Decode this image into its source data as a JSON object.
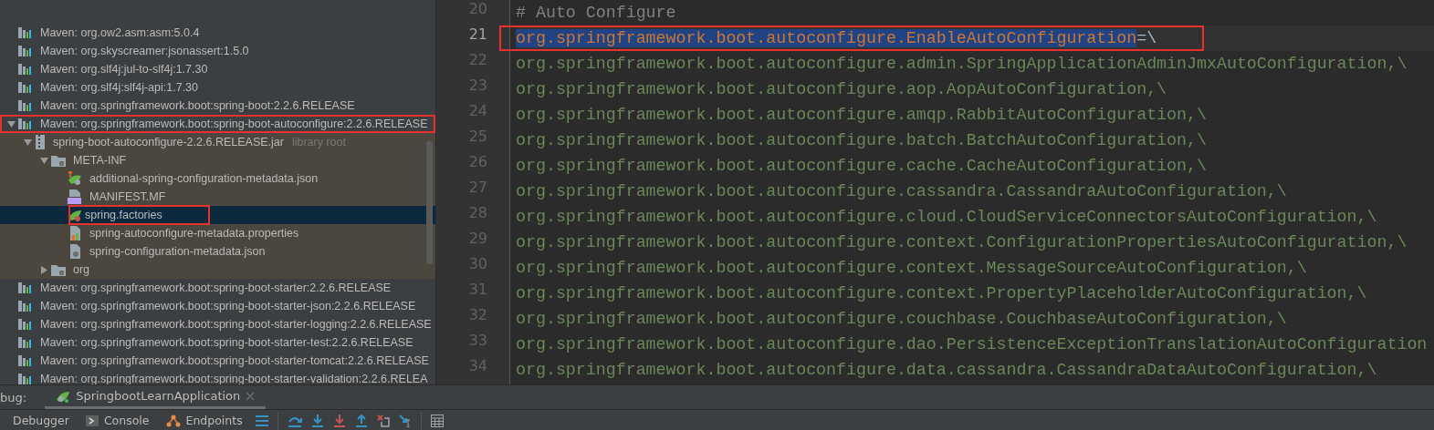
{
  "project_tree": [
    {
      "kind": "maven",
      "label": "Maven: org.ow2.asm:asm:5.0.4",
      "selected": false,
      "annotated": false
    },
    {
      "kind": "maven",
      "label": "Maven: org.skyscreamer:jsonassert:1.5.0",
      "selected": false,
      "annotated": false
    },
    {
      "kind": "maven",
      "label": "Maven: org.slf4j:jul-to-slf4j:1.7.30",
      "selected": false,
      "annotated": false
    },
    {
      "kind": "maven",
      "label": "Maven: org.slf4j:slf4j-api:1.7.30",
      "selected": false,
      "annotated": false
    },
    {
      "kind": "maven",
      "label": "Maven: org.springframework.boot:spring-boot:2.2.6.RELEASE",
      "selected": false,
      "annotated": false
    },
    {
      "kind": "maven",
      "label": "Maven: org.springframework.boot:spring-boot-autoconfigure:2.2.6.RELEASE",
      "selected": false,
      "annotated": true,
      "expanded": true,
      "children": [
        {
          "kind": "jar",
          "label": "spring-boot-autoconfigure-2.2.6.RELEASE.jar",
          "hint": "library root",
          "selected": false,
          "annotated": false,
          "expanded": true,
          "children": [
            {
              "kind": "folder",
              "label": "META-INF",
              "selected": false,
              "annotated": false,
              "expanded": true,
              "children": [
                {
                  "kind": "json-up",
                  "label": "additional-spring-configuration-metadata.json",
                  "selected": false,
                  "annotated": false
                },
                {
                  "kind": "manifest",
                  "label": "MANIFEST.MF",
                  "selected": false,
                  "annotated": false
                },
                {
                  "kind": "spring",
                  "label": "spring.factories",
                  "selected": true,
                  "annotated": true
                },
                {
                  "kind": "properties",
                  "label": "spring-autoconfigure-metadata.properties",
                  "selected": false,
                  "annotated": false
                },
                {
                  "kind": "json",
                  "label": "spring-configuration-metadata.json",
                  "selected": false,
                  "annotated": false
                }
              ]
            },
            {
              "kind": "folder",
              "label": "org",
              "selected": false,
              "annotated": false,
              "expanded": false
            }
          ]
        }
      ]
    },
    {
      "kind": "maven",
      "label": "Maven: org.springframework.boot:spring-boot-starter:2.2.6.RELEASE",
      "selected": false,
      "annotated": false
    },
    {
      "kind": "maven",
      "label": "Maven: org.springframework.boot:spring-boot-starter-json:2.2.6.RELEASE",
      "selected": false,
      "annotated": false
    },
    {
      "kind": "maven",
      "label": "Maven: org.springframework.boot:spring-boot-starter-logging:2.2.6.RELEASE",
      "selected": false,
      "annotated": false
    },
    {
      "kind": "maven",
      "label": "Maven: org.springframework.boot:spring-boot-starter-test:2.2.6.RELEASE",
      "selected": false,
      "annotated": false
    },
    {
      "kind": "maven",
      "label": "Maven: org.springframework.boot:spring-boot-starter-tomcat:2.2.6.RELEASE",
      "selected": false,
      "annotated": false
    },
    {
      "kind": "maven",
      "label": "Maven: org.springframework.boot:spring-boot-starter-validation:2.2.6.RELEA",
      "selected": false,
      "annotated": false
    }
  ],
  "editor": {
    "lines": [
      {
        "number": "20",
        "kind": "comment",
        "text": "# Auto Configure",
        "current": false,
        "annotated": false
      },
      {
        "number": "21",
        "kind": "key",
        "text": "org.springframework.boot.autoconfigure.EnableAutoConfiguration",
        "suffix": "=\\",
        "current": true,
        "annotated": true
      },
      {
        "number": "22",
        "kind": "value",
        "text": "org.springframework.boot.autoconfigure.admin.SpringApplicationAdminJmxAutoConfiguration,\\",
        "current": false,
        "annotated": false
      },
      {
        "number": "23",
        "kind": "value",
        "text": "org.springframework.boot.autoconfigure.aop.AopAutoConfiguration,\\",
        "current": false,
        "annotated": false
      },
      {
        "number": "24",
        "kind": "value",
        "text": "org.springframework.boot.autoconfigure.amqp.RabbitAutoConfiguration,\\",
        "current": false,
        "annotated": false
      },
      {
        "number": "25",
        "kind": "value",
        "text": "org.springframework.boot.autoconfigure.batch.BatchAutoConfiguration,\\",
        "current": false,
        "annotated": false
      },
      {
        "number": "26",
        "kind": "value",
        "text": "org.springframework.boot.autoconfigure.cache.CacheAutoConfiguration,\\",
        "current": false,
        "annotated": false
      },
      {
        "number": "27",
        "kind": "value",
        "text": "org.springframework.boot.autoconfigure.cassandra.CassandraAutoConfiguration,\\",
        "current": false,
        "annotated": false
      },
      {
        "number": "28",
        "kind": "value",
        "text": "org.springframework.boot.autoconfigure.cloud.CloudServiceConnectorsAutoConfiguration,\\",
        "current": false,
        "annotated": false
      },
      {
        "number": "29",
        "kind": "value",
        "text": "org.springframework.boot.autoconfigure.context.ConfigurationPropertiesAutoConfiguration,\\",
        "current": false,
        "annotated": false
      },
      {
        "number": "30",
        "kind": "value",
        "text": "org.springframework.boot.autoconfigure.context.MessageSourceAutoConfiguration,\\",
        "current": false,
        "annotated": false
      },
      {
        "number": "31",
        "kind": "value",
        "text": "org.springframework.boot.autoconfigure.context.PropertyPlaceholderAutoConfiguration,\\",
        "current": false,
        "annotated": false
      },
      {
        "number": "32",
        "kind": "value",
        "text": "org.springframework.boot.autoconfigure.couchbase.CouchbaseAutoConfiguration,\\",
        "current": false,
        "annotated": false
      },
      {
        "number": "33",
        "kind": "value",
        "text": "org.springframework.boot.autoconfigure.dao.PersistenceExceptionTranslationAutoConfiguration",
        "current": false,
        "annotated": false
      },
      {
        "number": "34",
        "kind": "value",
        "text": "org.springframework.boot.autoconfigure.data.cassandra.CassandraDataAutoConfiguration,\\",
        "current": false,
        "annotated": false
      }
    ]
  },
  "debug_panel": {
    "label": "bug:",
    "sessions": [
      {
        "label": "SpringbootLearnApplication",
        "selected": true
      }
    ],
    "tabs": [
      {
        "kind": "plain",
        "label": "Debugger"
      },
      {
        "kind": "console",
        "label": "Console"
      },
      {
        "kind": "endpoints",
        "label": "Endpoints"
      }
    ]
  }
}
